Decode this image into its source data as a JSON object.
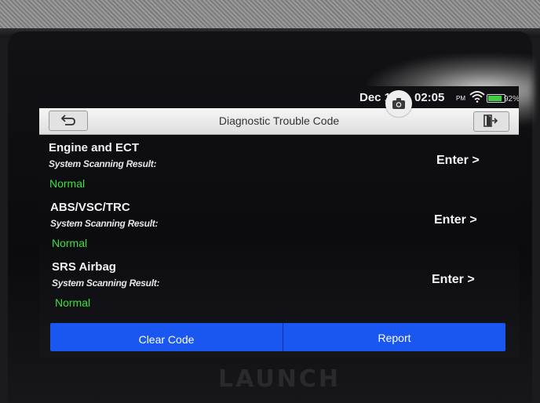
{
  "device": {
    "brand": "LAUNCH"
  },
  "status_bar": {
    "date": "Dec 1",
    "time": "02:05",
    "ampm": "PM",
    "battery_pct": "92%",
    "battery_level": 0.92
  },
  "header": {
    "title": "Diagnostic Trouble Code"
  },
  "systems": [
    {
      "name": "Engine and ECT",
      "result_label": "System Scanning Result:",
      "result": "Normal",
      "enter": "Enter >"
    },
    {
      "name": "ABS/VSC/TRC",
      "result_label": "System Scanning Result:",
      "result": "Normal",
      "enter": "Enter >"
    },
    {
      "name": "SRS Airbag",
      "result_label": "System Scanning Result:",
      "result": "Normal",
      "enter": "Enter >"
    }
  ],
  "actions": {
    "clear_code": "Clear Code",
    "report": "Report"
  },
  "colors": {
    "accent": "#1a56f0",
    "normal": "#3ce03c"
  },
  "icons": [
    "back-arrow-icon",
    "exit-door-icon",
    "camera-icon",
    "wifi-icon",
    "battery-icon"
  ]
}
